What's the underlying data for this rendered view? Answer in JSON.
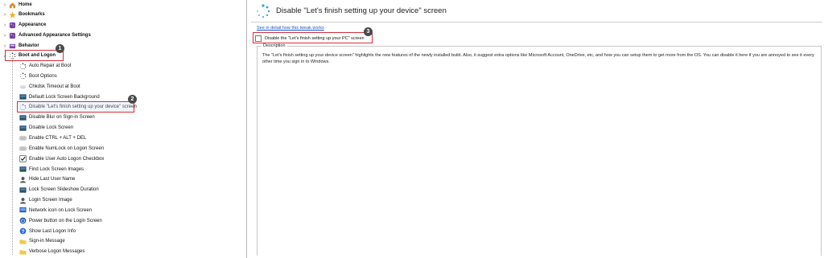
{
  "tree": {
    "root_items": [
      {
        "label": "Home",
        "icon": "home-icon",
        "bold": true
      },
      {
        "label": "Bookmarks",
        "icon": "star-icon",
        "bold": true
      },
      {
        "label": "Appearance",
        "icon": "palette-icon",
        "bold": true
      },
      {
        "label": "Advanced Appearance Settings",
        "icon": "palette-icon",
        "bold": true
      },
      {
        "label": "Behavior",
        "icon": "behavior-icon",
        "bold": true
      },
      {
        "label": "Boot and Logon",
        "icon": "boot-icon",
        "bold": true
      }
    ],
    "children": [
      {
        "label": "Auto Repair at Boot",
        "icon": "spinner-icon"
      },
      {
        "label": "Boot Options",
        "icon": "spinner-icon"
      },
      {
        "label": "Chkdsk Timeout at Boot",
        "icon": "disk-icon"
      },
      {
        "label": "Default Lock Screen Background",
        "icon": "lock-screen-icon"
      },
      {
        "label": "Disable \"Let's finish setting up your device\" screen",
        "icon": "spinner-icon"
      },
      {
        "label": "Disable Blur on Sign-in Screen",
        "icon": "lock-screen-icon"
      },
      {
        "label": "Disable Lock Screen",
        "icon": "lock-screen-icon"
      },
      {
        "label": "Enable CTRL + ALT + DEL",
        "icon": "keyboard-icon"
      },
      {
        "label": "Enable NumLock on Logon Screen",
        "icon": "keyboard-icon"
      },
      {
        "label": "Enable User Auto Logon Checkbox",
        "icon": "checkbox-icon"
      },
      {
        "label": "Find Lock Screen Images",
        "icon": "lock-screen-icon"
      },
      {
        "label": "Hide Last User Name",
        "icon": "user-icon"
      },
      {
        "label": "Lock Screen Slideshow Duration",
        "icon": "lock-screen-icon"
      },
      {
        "label": "Login Screen Image",
        "icon": "user-icon"
      },
      {
        "label": "Network icon on Lock Screen",
        "icon": "network-icon"
      },
      {
        "label": "Power button on the Login Screen",
        "icon": "power-icon"
      },
      {
        "label": "Show Last Logon Info",
        "icon": "help-icon"
      },
      {
        "label": "Sign-in Message",
        "icon": "folder-icon"
      },
      {
        "label": "Verbose Logon Messages",
        "icon": "folder-icon"
      }
    ],
    "expander_collapsed": "›",
    "expander_expanded": "⌄"
  },
  "badges": {
    "one": "1",
    "two": "2",
    "three": "3"
  },
  "detail": {
    "title": "Disable \"Let's finish setting up your device\" screen",
    "link": "See in detail how this tweak works",
    "checkbox_label": "Disable the \"Let's finish setting up your PC\" screen",
    "checkbox_checked": false,
    "description_legend": "Description",
    "description": "The \"Let's finish setting up your device screen\" highlights the new features of the newly installed build. Also, it suggest extra options like Microsoft Account, OneDrive, etc, and how you can setup them to get more from the OS. You can disable it here if you are annoyed to see it every other time you sign in to Windows."
  },
  "colors": {
    "highlight": "#d62f3a",
    "badge": "#4a4a4a",
    "link": "#1a55c4"
  }
}
